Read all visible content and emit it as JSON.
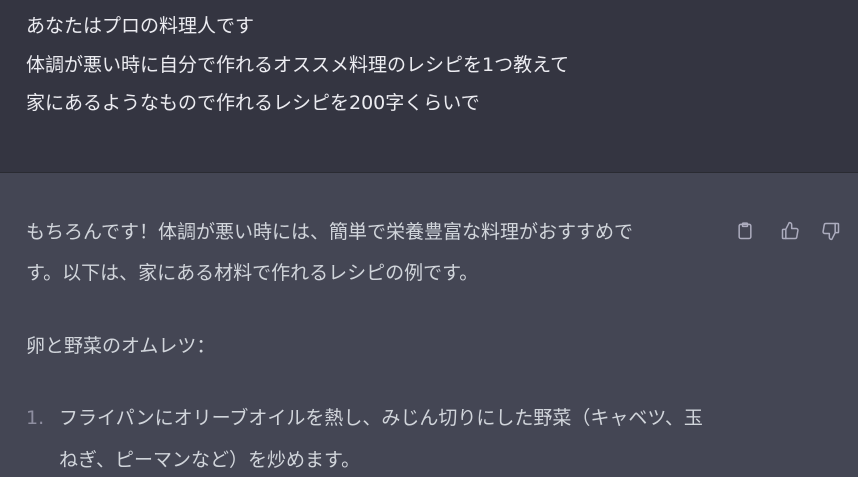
{
  "user_message": {
    "lines": [
      "あなたはプロの料理人です",
      "体調が悪い時に自分で作れるオススメ料理のレシピを1つ教えて",
      "家にあるようなもので作れるレシピを200字くらいで"
    ]
  },
  "assistant_message": {
    "paragraph_lines": [
      "もちろんです！体調が悪い時には、簡単で栄養豊富な料理がおすすめで",
      "す。以下は、家にある材料で作れるレシピの例です。"
    ],
    "recipe_title": "卵と野菜のオムレツ：",
    "steps": [
      {
        "number": "1.",
        "lines": [
          "フライパンにオリーブオイルを熱し、みじん切りにした野菜（キャベツ、玉",
          "ねぎ、ピーマンなど）を炒めます。"
        ]
      }
    ],
    "actions": {
      "copy_icon": "clipboard-icon",
      "like_icon": "thumbs-up-icon",
      "dislike_icon": "thumbs-down-icon"
    }
  },
  "colors": {
    "user_bg": "#343541",
    "assistant_bg": "#444654",
    "text": "#ececf1",
    "icon": "#acacbe"
  }
}
